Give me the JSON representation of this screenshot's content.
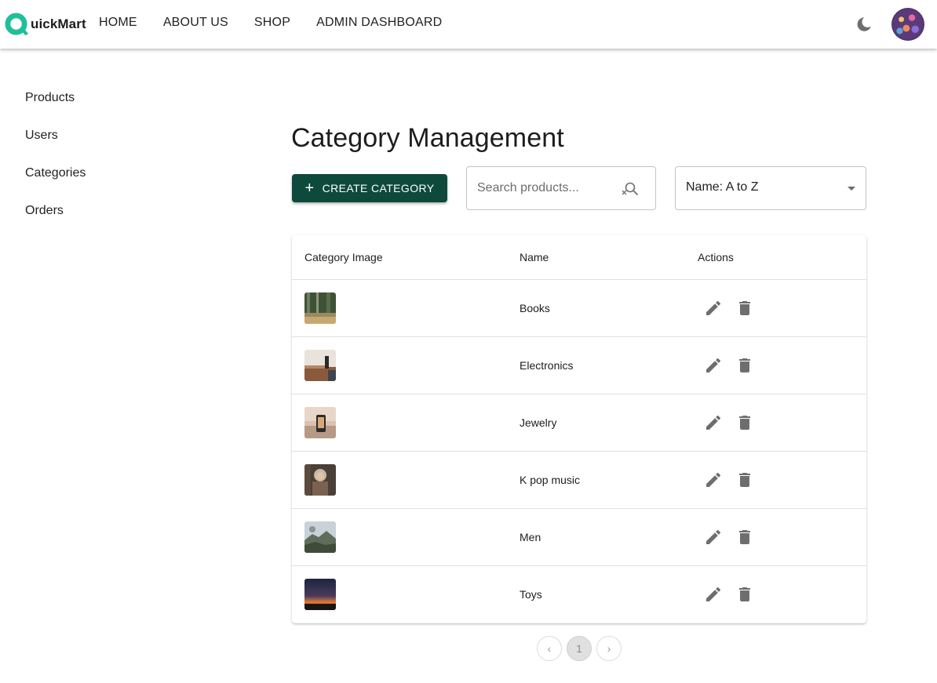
{
  "brand": {
    "name": "QuickMart",
    "logo_letter": "Q",
    "logo_rest": "uickMart",
    "accent": "#1fbf9a"
  },
  "nav": {
    "items": [
      "HOME",
      "ABOUT US",
      "SHOP",
      "ADMIN DASHBOARD"
    ]
  },
  "header_icons": {
    "theme_toggle": "moon-icon",
    "avatar": "user-avatar"
  },
  "sidebar": {
    "items": [
      "Products",
      "Users",
      "Categories",
      "Orders"
    ]
  },
  "main": {
    "title": "Category Management",
    "create_button": {
      "icon": "+",
      "label": "CREATE CATEGORY",
      "color": "#0e4a3c"
    },
    "search": {
      "placeholder": "Search products...",
      "value": ""
    },
    "sort": {
      "selected": "Name: A to Z"
    }
  },
  "table": {
    "columns": [
      "Category Image",
      "Name",
      "Actions"
    ],
    "rows": [
      {
        "name": "Books",
        "image": "forest-thumbnail"
      },
      {
        "name": "Electronics",
        "image": "desk-thumbnail"
      },
      {
        "name": "Jewelry",
        "image": "sunset-phone-thumbnail"
      },
      {
        "name": "K pop music",
        "image": "person-thumbnail"
      },
      {
        "name": "Men",
        "image": "mountain-thumbnail"
      },
      {
        "name": "Toys",
        "image": "dusk-thumbnail"
      }
    ],
    "row_actions": [
      "edit-icon",
      "delete-icon"
    ]
  },
  "pagination": {
    "prev": "‹",
    "current": "1",
    "next": "›"
  }
}
